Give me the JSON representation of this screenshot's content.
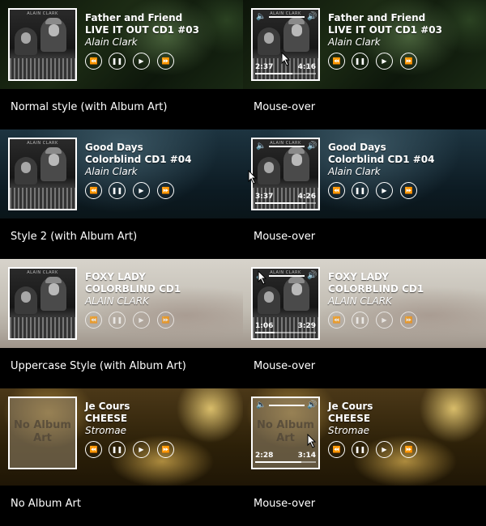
{
  "rows": [
    {
      "caption_left": "Normal style (with Album Art)",
      "caption_right": "Mouse-over",
      "art_label": "ALAIN CLARK",
      "title": "Father and Friend",
      "album": "LIVE IT OUT CD1 #03",
      "artist": "Alain Clark",
      "current_time": "2:37",
      "total_time": "4:16",
      "progress": 0.61
    },
    {
      "caption_left": "Style 2 (with Album Art)",
      "caption_right": "Mouse-over",
      "art_label": "ALAIN CLARK",
      "title": "Good Days",
      "album": "Colorblind CD1 #04",
      "artist": "Alain Clark",
      "current_time": "3:37",
      "total_time": "4:26",
      "progress": 0.82
    },
    {
      "caption_left": "Uppercase Style (with Album Art)",
      "caption_right": "Mouse-over",
      "art_label": "ALAIN CLARK",
      "title": "FOXY LADY",
      "album": "COLORBLIND CD1",
      "artist": "ALAIN CLARK",
      "current_time": "1:06",
      "total_time": "3:29",
      "progress": 0.32
    },
    {
      "caption_left": "No Album Art",
      "caption_right": "Mouse-over",
      "no_art_text": "No Album Art",
      "title": "Je Cours",
      "album": "CHEESE",
      "artist": "Stromae",
      "current_time": "2:28",
      "total_time": "3:14",
      "progress": 0.76
    }
  ],
  "controls": {
    "rewind_icon": "⏪",
    "pause_icon": "❚❚",
    "play_icon": "▶",
    "forward_icon": "⏩",
    "volume_low_icon": "🔈",
    "volume_high_icon": "🔊"
  },
  "volume_level": 0.55
}
